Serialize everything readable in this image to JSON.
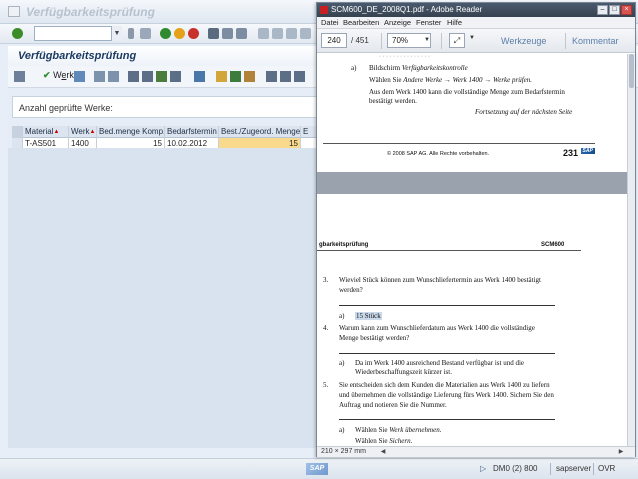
{
  "sap": {
    "window_title": "Verfügbarkeitsprüfung",
    "header_title": "Verfügbarkeitsprüfung",
    "werk_button": {
      "prefix": "W",
      "underlined": "e",
      "suffix": "rk"
    },
    "count_label": "Anzahl geprüfte Werke:",
    "table": {
      "headers": [
        "Material",
        "Werk",
        "Bed.menge Komp.",
        "Bedarfstermin",
        "Best./Zugeord. Menge",
        "E"
      ],
      "rows": [
        [
          "T-AS501",
          "1400",
          "15",
          "10.02.2012",
          "15",
          ""
        ]
      ]
    },
    "status": {
      "system": "DM0 (2) 800",
      "server": "sapserver",
      "mode": "OVR"
    }
  },
  "reader": {
    "window_title": "SCM600_DE_2008Q1.pdf - Adobe Reader",
    "menus": [
      "Datei",
      "Bearbeiten",
      "Anzeige",
      "Fenster",
      "Hilfe"
    ],
    "page_current": "240",
    "page_total": "/ 451",
    "zoom": "70%",
    "tools_label": "Werkzeuge",
    "comment_label": "Kommentar",
    "page_size": "210 × 297 mm",
    "page1": {
      "item_a_label": "a)",
      "item_a_line1": "Bildschirm ",
      "item_a_line1_i": "Verfügbarkeitskontrolle",
      "item_a_line2a": "Wählen Sie ",
      "item_a_line2_i": "Andere Werke → Werk 1400 → Werke prüfen.",
      "item_a_line3": "Aus dem Werk 1400 kann die vollständige Menge zum Bedarfstermin",
      "item_a_line4": "bestätigt werden.",
      "continued": "Fortsetzung auf der nächsten Seite",
      "copyright": "© 2008 SAP AG. Alle Rechte vorbehalten.",
      "page_no": "231",
      "sap_logo": "SAP"
    },
    "page2": {
      "header_left": "gbarkeitsprüfung",
      "header_right": "SCM600",
      "q3_num": "3.",
      "q3_line1": "Wieviel Stück können zum Wunschliefertermin aus Werk 1400 bestätigt",
      "q3_line2": "werden?",
      "q3_a": "a)",
      "q3_answer": "15 Stück",
      "q4_num": "4.",
      "q4_line1": "Warum kann zum Wunschlieferdatum aus Werk 1400 die vollständige",
      "q4_line2": "Menge bestätigt werden?",
      "q4_a": "a)",
      "q4_answer1": "Da im Werk 1400 ausreichend Bestand verfügbar ist und die",
      "q4_answer2": "Wiederbeschaffungszeit kürzer ist.",
      "q5_num": "5.",
      "q5_line1": "Sie entscheiden sich dem Kunden die Materialien aus Werk 1400 zu liefern",
      "q5_line2": "und übernehmen die vollständige Lieferung fürs Werk 1400. Sichern Sie den",
      "q5_line3": "Auftrag und notieren Sie die Nummer.",
      "q5_a": "a)",
      "q5_answer1a": "Wählen Sie ",
      "q5_answer1_i": "Werk übernehmen.",
      "q5_answer2a": "Wählen Sie ",
      "q5_answer2_i": "Sichern."
    }
  },
  "colors": {
    "sap_background": "#e7eef7",
    "sap_title": "#1d3a63",
    "highlight_cell": "#f9d98b",
    "reader_titlebar": "#36424f",
    "answer_highlight": "#c9d9ea"
  },
  "icons": [
    "table-icon",
    "enter-check-icon",
    "back-icon",
    "save-icon",
    "nav-icons",
    "continue-check-icon",
    "filter-icon",
    "sum-icon",
    "print-icon",
    "excel-icon",
    "layout-icon",
    "pdf-app-icon",
    "minimize-icon",
    "maximize-icon",
    "close-icon",
    "fit-page-icon"
  ]
}
